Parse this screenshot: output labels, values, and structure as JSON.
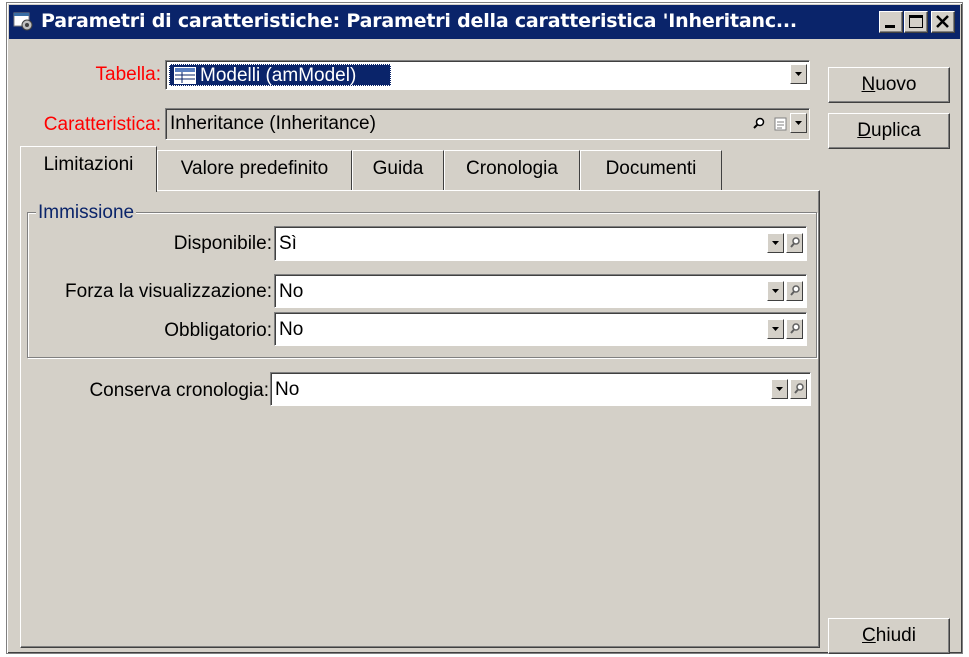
{
  "window": {
    "title": "Parametri di caratteristiche: Parametri della caratteristica 'Inheritanc...",
    "icon": "gear-window-icon",
    "controls": [
      "minimize-icon",
      "maximize-icon",
      "close-icon"
    ]
  },
  "header": {
    "table_label": "Tabella:",
    "table_value": "Modelli (amModel)",
    "table_icon": "table-icon",
    "feature_label": "Caratteristica:",
    "feature_value": "Inheritance (Inheritance)"
  },
  "buttons": {
    "new_label": "Nuovo",
    "duplicate_label": "Duplica",
    "close_label": "Chiudi"
  },
  "tabs": [
    {
      "label": "Limitazioni",
      "active": true
    },
    {
      "label": "Valore predefinito",
      "active": false
    },
    {
      "label": "Guida",
      "active": false
    },
    {
      "label": "Cronologia",
      "active": false
    },
    {
      "label": "Documenti",
      "active": false
    }
  ],
  "group": {
    "title": "Immissione",
    "fields": [
      {
        "label": "Disponibile:",
        "value": "Sì"
      },
      {
        "label": "Forza la visualizzazione:",
        "value": "No"
      },
      {
        "label": "Obbligatorio:",
        "value": "No"
      }
    ]
  },
  "history": {
    "label": "Conserva cronologia:",
    "value": "No"
  },
  "colors": {
    "titlebar": "#0a246a",
    "face": "#d4d0c8",
    "required_label": "#ff0000",
    "group_title": "#0a246a",
    "selection": "#0a246a"
  }
}
